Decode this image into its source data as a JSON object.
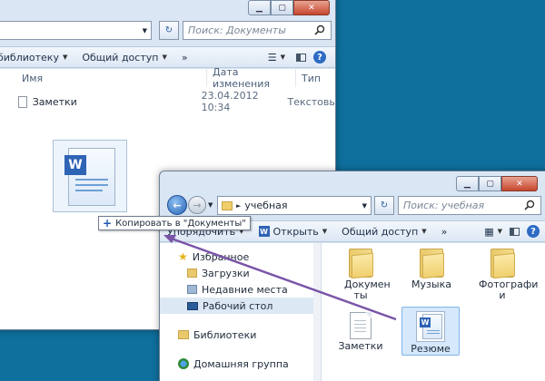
{
  "window_back": {
    "search_placeholder": "Поиск: Документы",
    "toolbar": {
      "library": "библиотеку",
      "share": "Общий доступ",
      "more": "»"
    },
    "columns": {
      "name": "Имя",
      "date": "Дата изменения",
      "type": "Тип"
    },
    "files": [
      {
        "name": "Заметки",
        "date": "23.04.2012 10:34",
        "type": "Текстовы"
      }
    ]
  },
  "drag": {
    "tooltip": "Копировать в \"Документы\""
  },
  "window_front": {
    "address": "учебная",
    "address_sep": "►",
    "search_placeholder": "Поиск: учебная",
    "toolbar": {
      "organize": "Упорядочить",
      "open": "Открыть",
      "share": "Общий доступ",
      "more": "»"
    },
    "nav": {
      "favorites": "Избранное",
      "downloads": "Загрузки",
      "recent": "Недавние места",
      "desktop": "Рабочий стол",
      "libraries": "Библиотеки",
      "homegroup": "Домашняя группа"
    },
    "items": {
      "documents": "Докумен ты",
      "music": "Музыка",
      "photos": "Фотографи и",
      "notes": "Заметки",
      "resume": "Резюме"
    }
  },
  "colors": {
    "desktop": "#0f6f9d",
    "drag_line": "#7a55a8",
    "selection": "#d6e8fb"
  }
}
